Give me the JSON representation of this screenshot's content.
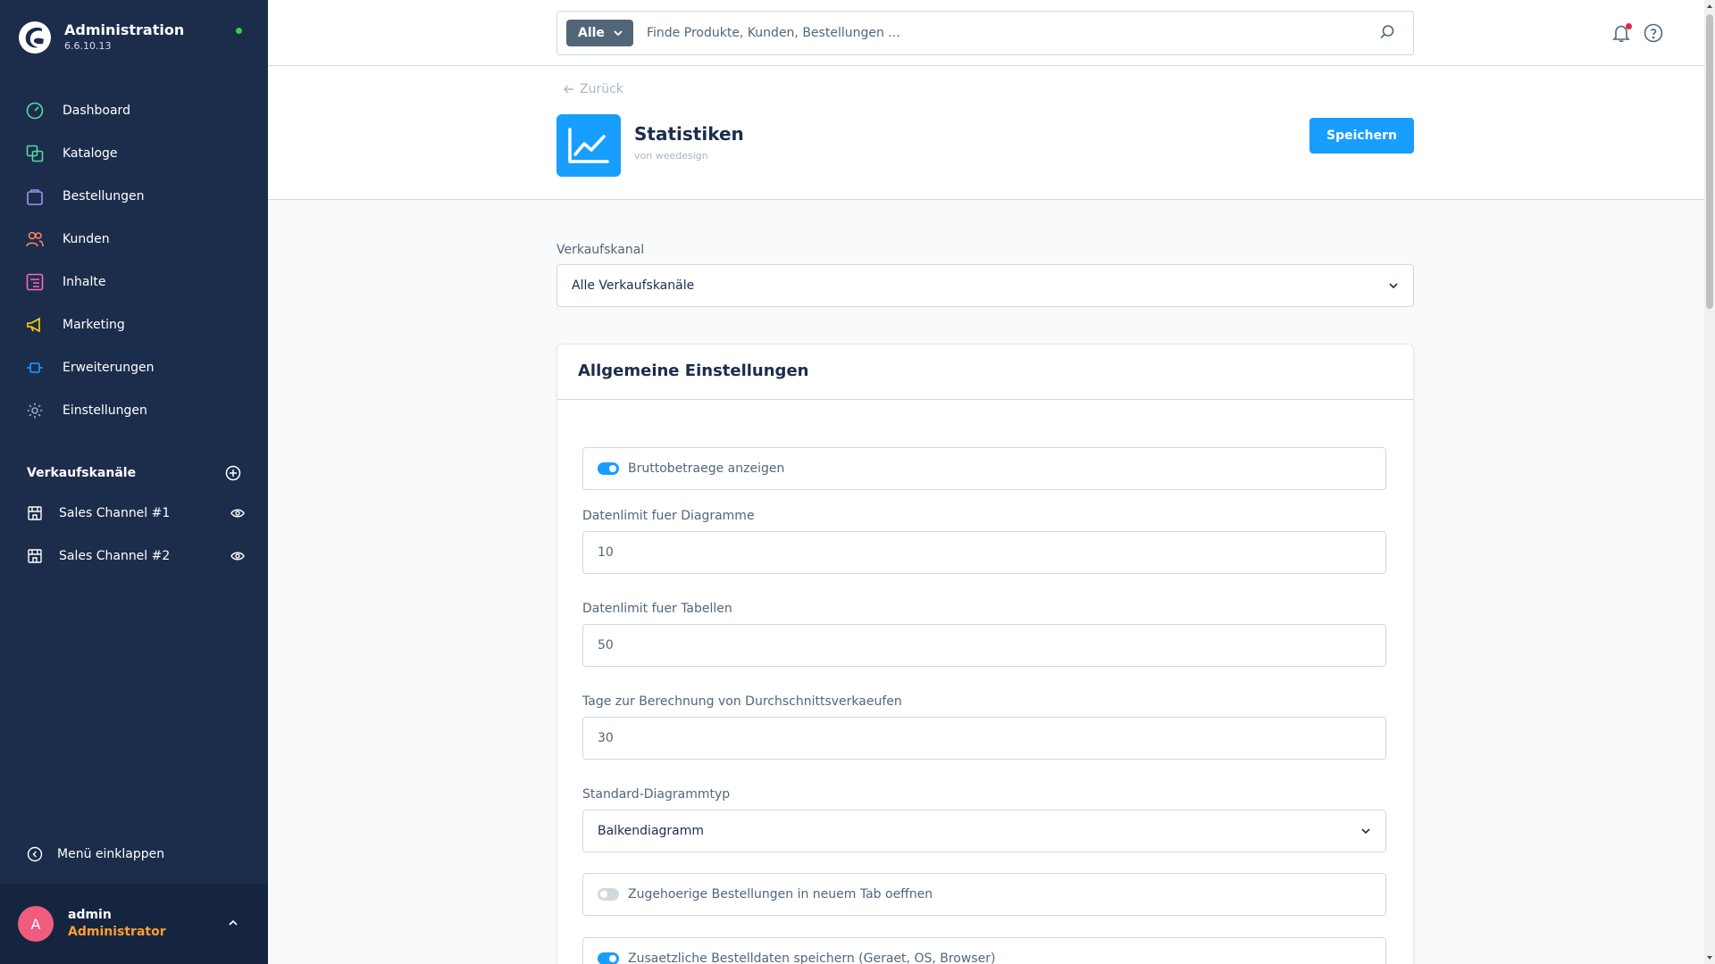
{
  "sidebar": {
    "brand_title": "Administration",
    "brand_version": "6.6.10.13",
    "nav": [
      {
        "label": "Dashboard",
        "icon": "dashboard-icon",
        "color": "#57d9a3"
      },
      {
        "label": "Kataloge",
        "icon": "catalog-icon",
        "color": "#57d9a3"
      },
      {
        "label": "Bestellungen",
        "icon": "orders-icon",
        "color": "#a092f0"
      },
      {
        "label": "Kunden",
        "icon": "customers-icon",
        "color": "#f88962"
      },
      {
        "label": "Inhalte",
        "icon": "content-icon",
        "color": "#ff68b4"
      },
      {
        "label": "Marketing",
        "icon": "marketing-icon",
        "color": "#ffd700"
      },
      {
        "label": "Erweiterungen",
        "icon": "extensions-icon",
        "color": "#189eff"
      },
      {
        "label": "Einstellungen",
        "icon": "settings-icon",
        "color": "#9aa8b5"
      }
    ],
    "channels_title": "Verkaufskanäle",
    "channels": [
      {
        "label": "Sales Channel #1"
      },
      {
        "label": "Sales Channel #2"
      }
    ],
    "collapse_label": "Menü einklappen",
    "user": {
      "initial": "A",
      "name": "admin",
      "role": "Administrator"
    }
  },
  "topbar": {
    "search_type": "Alle",
    "search_placeholder": "Finde Produkte, Kunden, Bestellungen ..."
  },
  "header": {
    "back_label": "Zurück",
    "app_title": "Statistiken",
    "app_vendor": "von weedesign",
    "save_label": "Speichern"
  },
  "content": {
    "channel_label": "Verkaufskanal",
    "channel_value": "Alle Verkaufskanäle",
    "card_title": "Allgemeine Einstellungen",
    "toggle_gross": {
      "label": "Bruttobetraege anzeigen",
      "on": true
    },
    "chart_limit": {
      "label": "Datenlimit fuer Diagramme",
      "value": "10"
    },
    "table_limit": {
      "label": "Datenlimit fuer Tabellen",
      "value": "50"
    },
    "avg_days": {
      "label": "Tage zur Berechnung von Durchschnittsverkaeufen",
      "value": "30"
    },
    "chart_type": {
      "label": "Standard-Diagrammtyp",
      "value": "Balkendiagramm"
    },
    "toggle_newtab": {
      "label": "Zugehoerige Bestellungen in neuem Tab oeffnen",
      "on": false
    },
    "toggle_extra": {
      "label": "Zusaetzliche Bestelldaten speichern (Geraet, OS, Browser)",
      "on": true
    }
  }
}
